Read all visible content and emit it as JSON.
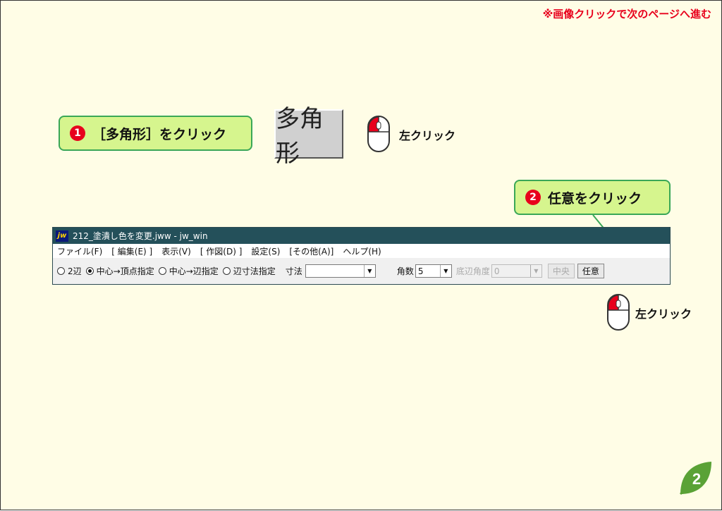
{
  "header": {
    "nav_note": "※画像クリックで次のページへ進む"
  },
  "step1": {
    "number": "❶",
    "text": "［多角形］をクリック",
    "button_label": "多角形",
    "click_label": "左クリック"
  },
  "step2": {
    "number": "❷",
    "text": "任意をクリック",
    "click_label": "左クリック"
  },
  "window": {
    "title": "212_塗潰し色を変更.jww - jw_win",
    "logo": "jw",
    "menu": [
      "ファイル(F)",
      "[ 編集(E) ]",
      "表示(V)",
      "[ 作図(D) ]",
      "設定(S)",
      "[その他(A)]",
      "ヘルプ(H)"
    ],
    "toolbar": {
      "radio_2hen": "2辺",
      "radio_center_vertex": "中心→頂点指定",
      "radio_center_edge": "中心→辺指定",
      "radio_edge_dim": "辺寸法指定",
      "dim_label": "寸法",
      "dim_value": "",
      "angles_label": "角数",
      "angles_value": "5",
      "base_angle_label": "底辺角度",
      "base_angle_value": "0",
      "center_button": "中央",
      "arbitrary_button": "任意"
    }
  },
  "page_number": "2",
  "colors": {
    "callout_bg": "#d6f58e",
    "callout_border": "#3aa757",
    "accent_red": "#e8001c",
    "titlebar": "#24505a",
    "page_bg": "#fffde6"
  }
}
